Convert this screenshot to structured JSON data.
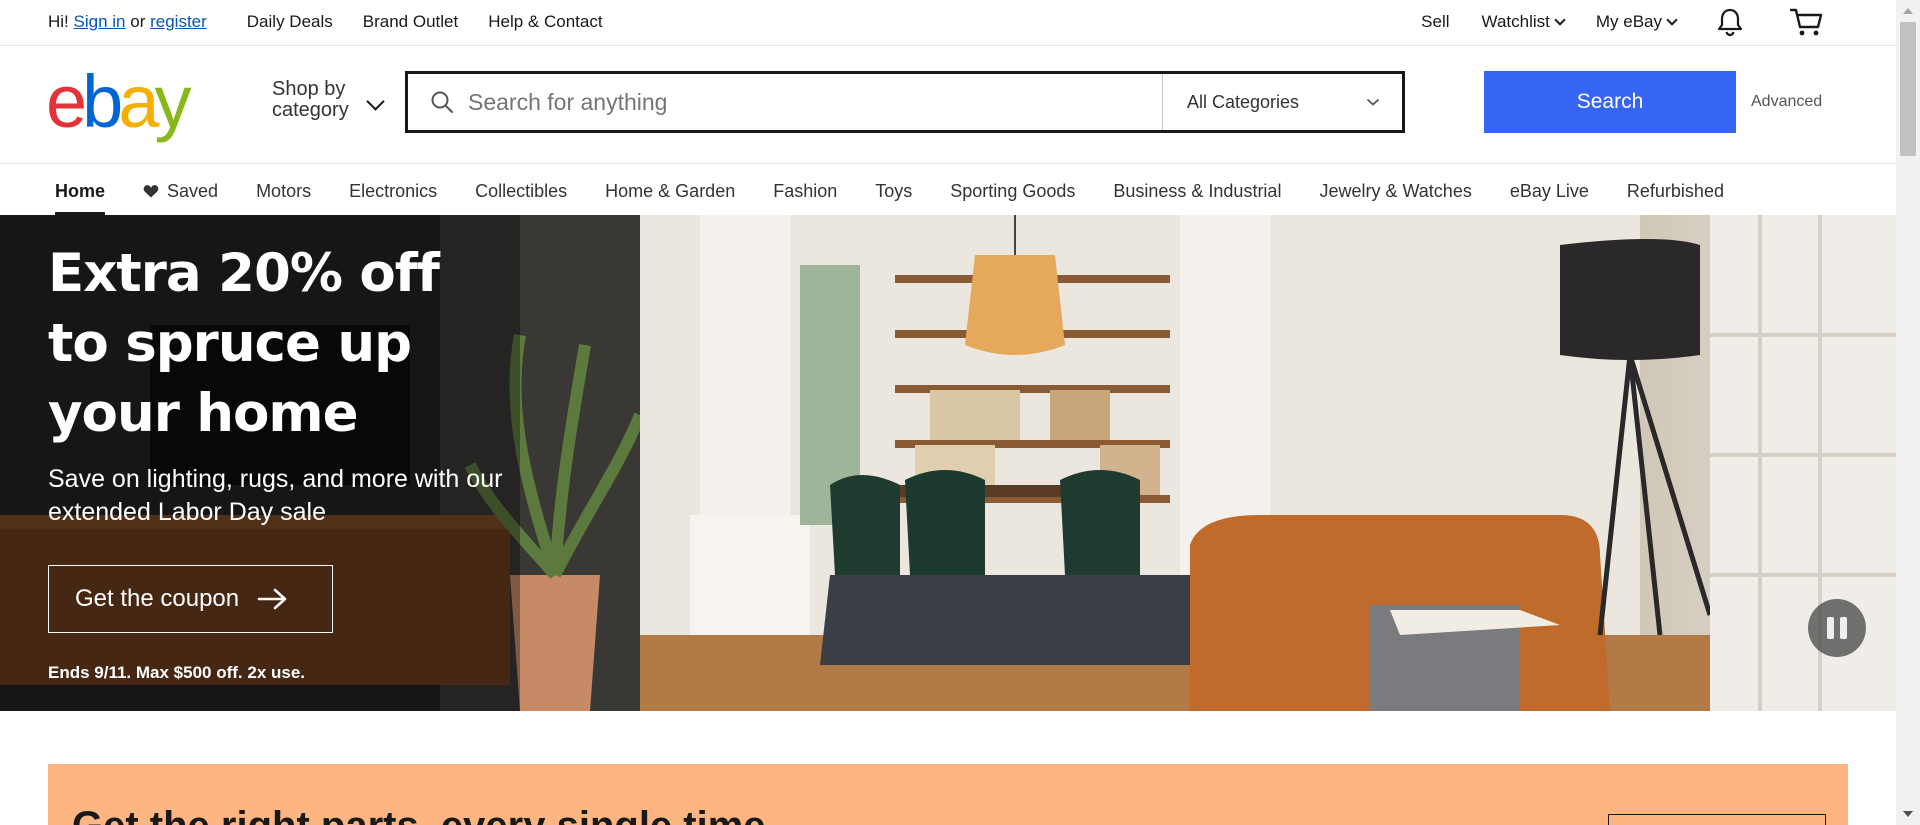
{
  "topbar": {
    "greeting": "Hi!",
    "sign_in": "Sign in",
    "or": "or",
    "register": "register",
    "links": [
      "Daily Deals",
      "Brand Outlet",
      "Help & Contact"
    ],
    "sell": "Sell",
    "watchlist": "Watchlist",
    "my_ebay": "My eBay",
    "icons": {
      "notification": "bell-icon",
      "cart": "cart-icon"
    }
  },
  "header": {
    "logo": {
      "e": "e",
      "b": "b",
      "a": "a",
      "y": "y"
    },
    "shop_by": "Shop by",
    "shop_by_2": "category",
    "search_placeholder": "Search for anything",
    "category_selected": "All Categories",
    "search_button": "Search",
    "advanced": "Advanced"
  },
  "nav": {
    "items": [
      "Home",
      "Saved",
      "Motors",
      "Electronics",
      "Collectibles",
      "Home & Garden",
      "Fashion",
      "Toys",
      "Sporting Goods",
      "Business & Industrial",
      "Jewelry & Watches",
      "eBay Live",
      "Refurbished"
    ],
    "active": "Home"
  },
  "hero": {
    "title": "Extra 20% off to spruce up your home",
    "subtitle": "Save on lighting, rugs, and more with our extended Labor Day sale",
    "cta": "Get the coupon",
    "fine_print": "Ends 9/11. Max $500 off. 2x use."
  },
  "promo": {
    "title": "Get the right parts, every single time"
  },
  "colors": {
    "accent": "#3665f3",
    "link": "#0654ba",
    "promo_bg": "#fdb682",
    "logo_e": "#e53238",
    "logo_b": "#0064d2",
    "logo_a": "#f5af02",
    "logo_y": "#86b817"
  }
}
